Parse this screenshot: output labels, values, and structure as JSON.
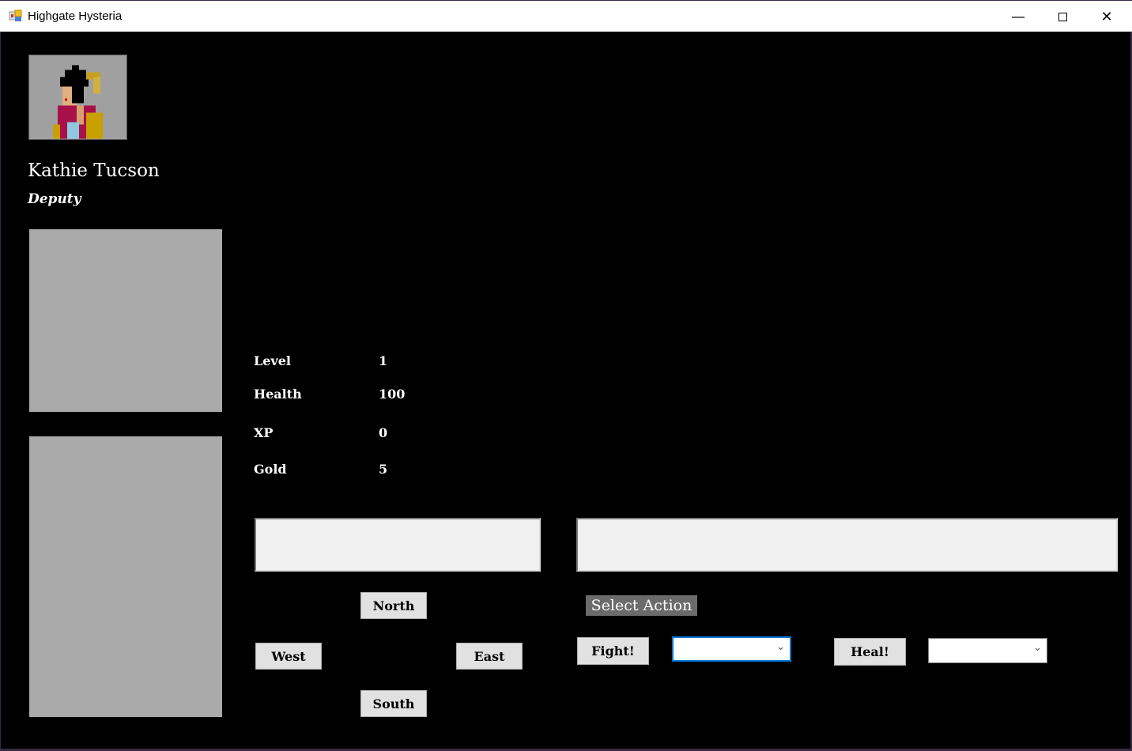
{
  "window": {
    "title": "Highgate Hysteria",
    "icon": "app-icon",
    "controls": [
      "minimize",
      "maximize",
      "close"
    ]
  },
  "player": {
    "name": "Kathie Tucson",
    "role": "Deputy",
    "portrait": "deputy-portrait"
  },
  "stats": [
    {
      "label": "Level",
      "value": "1"
    },
    {
      "label": "Health",
      "value": "100"
    },
    {
      "label": "XP",
      "value": "0"
    },
    {
      "label": "Gold",
      "value": "5"
    }
  ],
  "textboxes": {
    "location": "",
    "messages": ""
  },
  "movement": {
    "north": "North",
    "west": "West",
    "east": "East",
    "south": "South"
  },
  "actions": {
    "select_label": "Select Action",
    "fight": "Fight!",
    "heal": "Heal!",
    "weapon_selected": "",
    "potion_selected": ""
  },
  "colors": {
    "background": "#000000",
    "panel": "#aaaaaa",
    "button": "#e1e1e1",
    "focus_border": "#0078d7"
  }
}
